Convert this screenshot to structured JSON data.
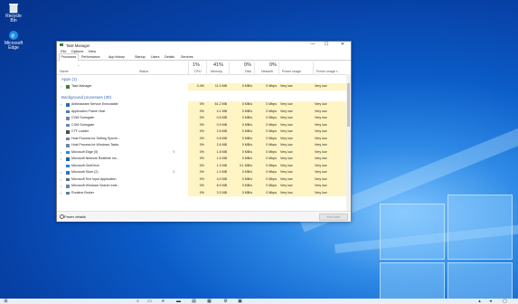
{
  "desktop": {
    "icons": [
      {
        "label": "Recycle Bin",
        "icon": "recycle-bin-icon"
      },
      {
        "label": "Microsoft Edge",
        "icon": "edge-icon"
      }
    ]
  },
  "window": {
    "title": "Task Manager",
    "controls": {
      "minimize": "—",
      "maximize": "☐",
      "close": "✕"
    },
    "menu": [
      "File",
      "Options",
      "View"
    ],
    "tabs": [
      "Processes",
      "Performance",
      "App history",
      "Startup",
      "Users",
      "Details",
      "Services"
    ],
    "active_tab": "Processes"
  },
  "header": {
    "name": "Name",
    "status": "Status",
    "cpu": {
      "pct": "1%",
      "label": "CPU"
    },
    "memory": {
      "pct": "41%",
      "label": "Memory"
    },
    "disk": {
      "pct": "0%",
      "label": "Disk"
    },
    "network": {
      "pct": "0%",
      "label": "Network"
    },
    "power": "Power usage",
    "power_trend": "Power usage t..."
  },
  "groups": {
    "apps": "Apps (1)",
    "background": "Background processes (30)"
  },
  "apps": [
    {
      "name": "Task Manager",
      "cpu": "0.4%",
      "mem": "11.0 MB",
      "disk": "0 MB/s",
      "net": "0 Mbps",
      "power": "Very low",
      "trend": "Very low",
      "expand": true,
      "icon": "task-manager-icon"
    }
  ],
  "background": [
    {
      "name": "Antimalware Service Executable",
      "cpu": "0%",
      "mem": "61.2 MB",
      "disk": "0 MB/s",
      "net": "0 Mbps",
      "power": "Very low",
      "trend": "Very low",
      "expand": true,
      "icon": "shield-icon"
    },
    {
      "name": "Application Frame Host",
      "cpu": "0%",
      "mem": "4.1 MB",
      "disk": "0 MB/s",
      "net": "0 Mbps",
      "power": "Very low",
      "trend": "Very low",
      "expand": false,
      "icon": "app-frame-icon"
    },
    {
      "name": "COM Surrogate",
      "cpu": "0%",
      "mem": "0.8 MB",
      "disk": "0 MB/s",
      "net": "0 Mbps",
      "power": "Very low",
      "trend": "Very low",
      "expand": false,
      "icon": "com-icon"
    },
    {
      "name": "COM Surrogate",
      "cpu": "0%",
      "mem": "0.9 MB",
      "disk": "0 MB/s",
      "net": "0 Mbps",
      "power": "Very low",
      "trend": "Very low",
      "expand": false,
      "icon": "com-icon"
    },
    {
      "name": "CTF Loader",
      "cpu": "0%",
      "mem": "2.8 MB",
      "disk": "0 MB/s",
      "net": "0 Mbps",
      "power": "Very low",
      "trend": "Very low",
      "expand": false,
      "icon": "ctf-loader-icon"
    },
    {
      "name": "Host Process for Setting Synchr...",
      "cpu": "0%",
      "mem": "0.8 MB",
      "disk": "0 MB/s",
      "net": "0 Mbps",
      "power": "Very low",
      "trend": "Very low",
      "expand": false,
      "icon": "host-process-icon"
    },
    {
      "name": "Host Process for Windows Tasks",
      "cpu": "0%",
      "mem": "2.6 MB",
      "disk": "0 MB/s",
      "net": "0 Mbps",
      "power": "Very low",
      "trend": "Very low",
      "expand": false,
      "icon": "host-process-icon"
    },
    {
      "name": "Microsoft Edge (5)",
      "cpu": "0%",
      "mem": "1.8 MB",
      "disk": "0 MB/s",
      "net": "0 Mbps",
      "power": "Very low",
      "trend": "Very low",
      "expand": true,
      "icon": "edge-icon",
      "leaf": true
    },
    {
      "name": "Microsoft Network Realtime Ins...",
      "cpu": "0%",
      "mem": "1.6 MB",
      "disk": "0 MB/s",
      "net": "0 Mbps",
      "power": "Very low",
      "trend": "Very low",
      "expand": true,
      "icon": "network-icon"
    },
    {
      "name": "Microsoft OneDrive",
      "cpu": "0%",
      "mem": "1.0 MB",
      "disk": "0.1 MB/s",
      "net": "0 Mbps",
      "power": "Very low",
      "trend": "Very low",
      "expand": false,
      "icon": "onedrive-icon"
    },
    {
      "name": "Microsoft Store (2)",
      "cpu": "0%",
      "mem": "1.0 MB",
      "disk": "0 MB/s",
      "net": "0 Mbps",
      "power": "Very low",
      "trend": "Very low",
      "expand": true,
      "icon": "store-icon",
      "leaf": true
    },
    {
      "name": "Microsoft Text Input Application",
      "cpu": "0%",
      "mem": "4.0 MB",
      "disk": "0 MB/s",
      "net": "0 Mbps",
      "power": "Very low",
      "trend": "Very low",
      "expand": true,
      "icon": "text-input-icon"
    },
    {
      "name": "Microsoft Windows Search Inde...",
      "cpu": "0%",
      "mem": "8.9 MB",
      "disk": "0 MB/s",
      "net": "0 Mbps",
      "power": "Very low",
      "trend": "Very low",
      "expand": true,
      "icon": "search-indexer-icon"
    },
    {
      "name": "Runtime Broker",
      "cpu": "0%",
      "mem": "3.3 MB",
      "disk": "0 MB/s",
      "net": "0 Mbps",
      "power": "Very low",
      "trend": "Very low",
      "expand": true,
      "icon": "runtime-broker-icon"
    }
  ],
  "footer": {
    "fewer_details": "Fewer details",
    "end_task": "End task"
  },
  "colors": {
    "highlight": "#fff4c4",
    "group_title": "#2f66b5",
    "accent": "#0b5cc8"
  }
}
